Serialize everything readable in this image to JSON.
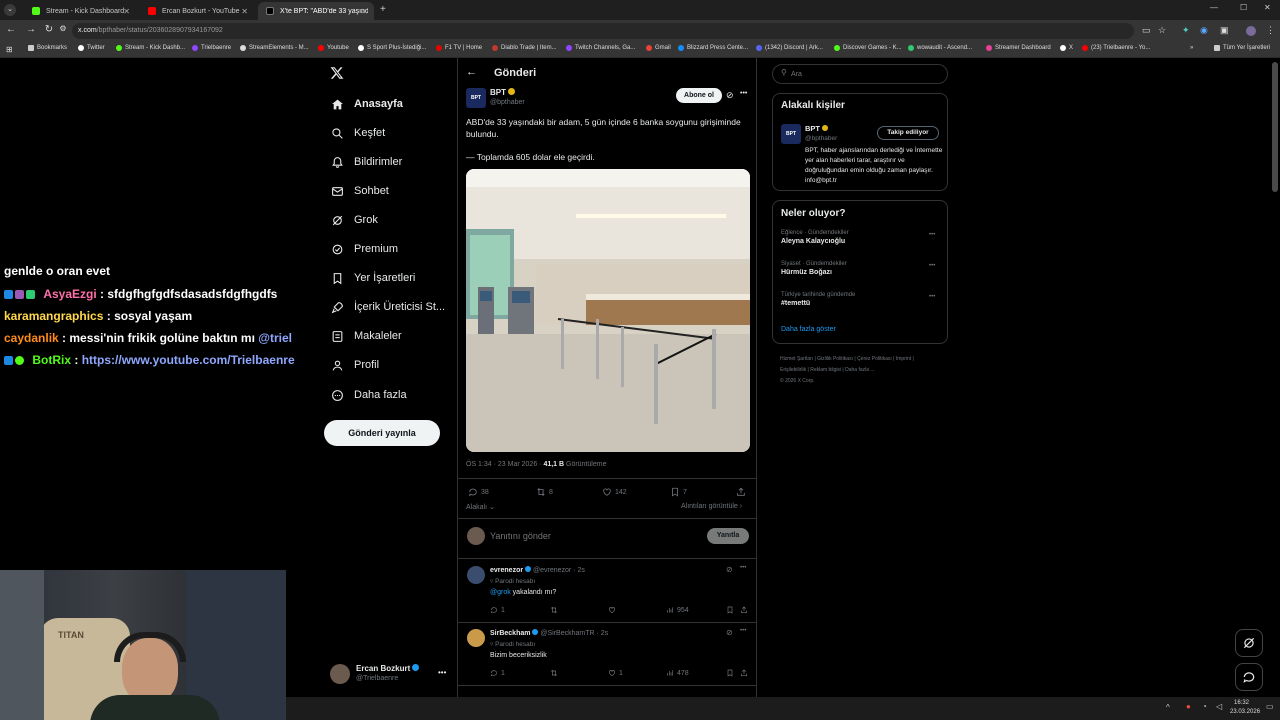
{
  "tabs": [
    {
      "label": "Stream - Kick Dashboard",
      "color": "#53fc18"
    },
    {
      "label": "Ercan Bozkurt - YouTube",
      "color": "#ff0000"
    },
    {
      "label": "X'te BPT: \"ABD'de 33 yaşındakı",
      "color": "#ffffff"
    }
  ],
  "address": {
    "host": "x.com",
    "path": "/bpthaber/status/2036028907934167092"
  },
  "bookmarks": [
    "Bookmarks",
    "Twitter",
    "Stream - Kick Dashb...",
    "Trielbaenre",
    "StreamElements - M...",
    "Youtube",
    "S Sport Plus-İstediği...",
    "F1 TV | Home",
    "Diablo Trade | Item...",
    "Twitch Channels, Ga...",
    "Gmail",
    "Blizzard Press Cente...",
    "(1342) Discord | Ark...",
    "Discover Games - K...",
    "wowaudit - Ascend...",
    "Streamer Dashboard",
    "X",
    "(23) Trielbaenre - Yo...",
    "Tüm Yer İşaretleri"
  ],
  "chat": {
    "partial": "genlde o oran evet",
    "messages": [
      {
        "user": "AsyaEzgi",
        "text": ": sfdgfhgfgdfsdasadsfdgfhgdfs",
        "color": "#ff6fa8"
      },
      {
        "user": "karamangraphics",
        "text": ": sosyal yaşam",
        "color": "#ffd84a"
      },
      {
        "user": "caydanlik",
        "text": ": messi'nin frikik golüne baktın mı ",
        "color": "#ff8c1a",
        "mention": "@triel"
      },
      {
        "user": "BotRix",
        "text": ": ",
        "color": "#53fc18",
        "link": "https://www.youtube.com/Trielbaenre"
      }
    ]
  },
  "webcam": {
    "chair_brand": "TITAN"
  },
  "nav": {
    "items": [
      {
        "label": "Anasayfa",
        "icon": "home-icon"
      },
      {
        "label": "Keşfet",
        "icon": "search-icon"
      },
      {
        "label": "Bildirimler",
        "icon": "bell-icon"
      },
      {
        "label": "Sohbet",
        "icon": "mail-icon"
      },
      {
        "label": "Grok",
        "icon": "grok-icon"
      },
      {
        "label": "Premium",
        "icon": "premium-icon"
      },
      {
        "label": "Yer İşaretleri",
        "icon": "bookmark-icon"
      },
      {
        "label": "İçerik Üreticisi St...",
        "icon": "rocket-icon"
      },
      {
        "label": "Makaleler",
        "icon": "articles-icon"
      },
      {
        "label": "Profil",
        "icon": "profile-icon"
      },
      {
        "label": "Daha fazla",
        "icon": "more-icon"
      }
    ],
    "post_button": "Gönderi yayınla",
    "account": {
      "name": "Ercan Bozkurt",
      "handle": "@Trielbaenre"
    }
  },
  "post": {
    "header_title": "Gönderi",
    "author": {
      "name": "BPT",
      "handle": "@bpthaber",
      "avatar_text": "BPT"
    },
    "subscribe_label": "Abone ol",
    "text1": "ABD'de 33 yaşındaki bir adam, 5 gün içinde 6 banka soygunu girişiminde bulundu.",
    "text2": "— Toplamda 605 dolar ele geçirdi.",
    "time": "ÖS 1:34 · 23 Mar 2026 · ",
    "views_count": "41,1 B",
    "views_label": " Görüntüleme",
    "stats": {
      "replies": "38",
      "reposts": "8",
      "likes": "142",
      "bookmarks": "7"
    },
    "related_label": "Alakalı",
    "quotes_label": "Alıntıları görüntüle",
    "reply_placeholder": "Yanıtını gönder",
    "reply_button": "Yanıtla"
  },
  "replies": [
    {
      "name": "evrenezor",
      "handle": "@evrenezor · 2s",
      "badge": "Parodi hesabı",
      "mention": "@grok",
      "text": " yakalandı mı?",
      "replies": "1",
      "reposts": "",
      "likes": "",
      "views": "954"
    },
    {
      "name": "SirBeckham",
      "handle": "@SirBeckhamTR · 2s",
      "badge": "Parodi hesabı",
      "mention": "",
      "text": "Bizim beceriksizlik",
      "replies": "1",
      "reposts": "",
      "likes": "1",
      "views": "478"
    }
  ],
  "right": {
    "search_placeholder": "Ara",
    "related_title": "Alakalı kişiler",
    "related_person": {
      "name": "BPT",
      "handle": "@bpthaber",
      "follow_label": "Takip ediliyor",
      "bio": "BPT, haber ajanslarından derlediği ve İnternette yer alan haberleri tarar, araştırır ve doğruluğundan emin olduğu zaman paylaşır. info@bpt.tr"
    },
    "trending_title": "Neler oluyor?",
    "trends": [
      {
        "category": "Eğlence · Gündemdekiler",
        "name": "Aleyna Kalaycıoğlu"
      },
      {
        "category": "Siyaset · Gündemdekiler",
        "name": "Hürmüz Boğazı"
      },
      {
        "category": "Türkiye tarihinde gündemde",
        "name": "#temettü"
      }
    ],
    "show_more": "Daha fazla göster",
    "footer": [
      "Hizmet Şartları",
      "Gizlilik Politikası",
      "Çerez Politikası",
      "Imprint",
      "Erişilebilirlik",
      "Reklam bilgisi",
      "Daha fazla ...",
      "© 2026 X Corp."
    ]
  },
  "taskbar": {
    "time": "16:32",
    "date": "23.03.2026"
  }
}
